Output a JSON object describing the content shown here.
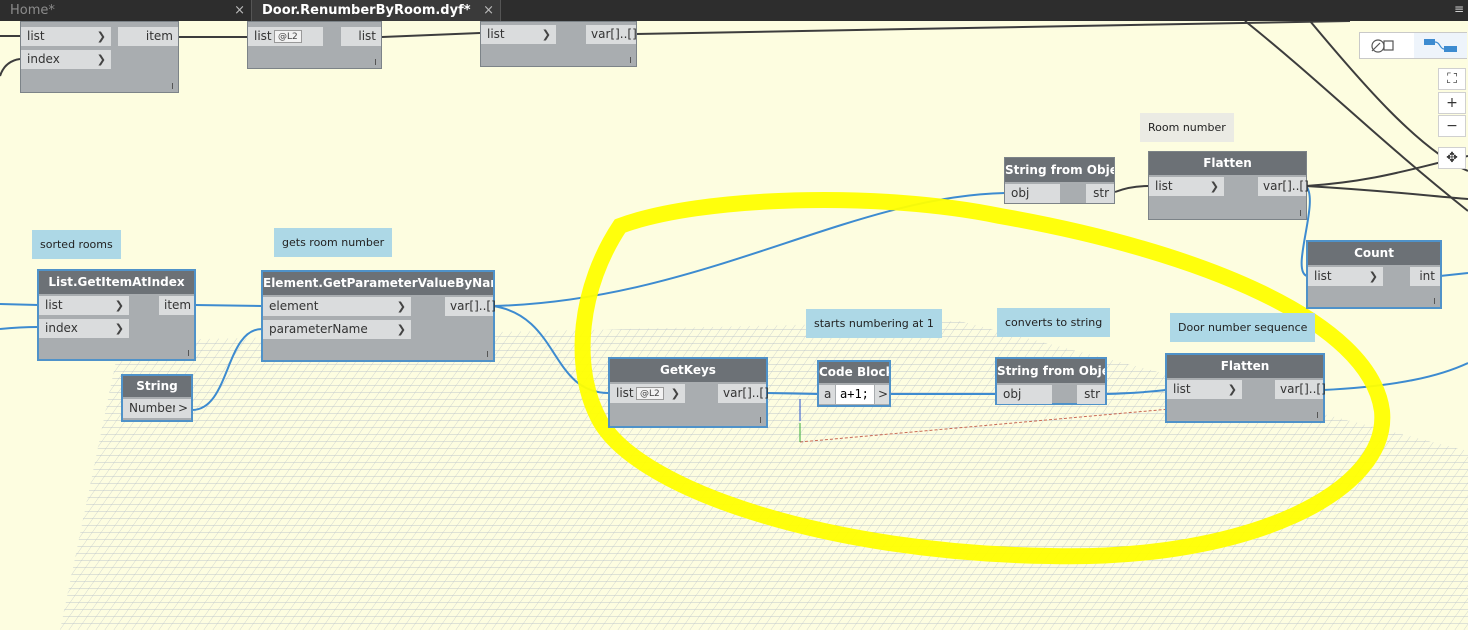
{
  "tabs": [
    {
      "label": "Home*",
      "close": "×"
    },
    {
      "label": "Door.RenumberByRoom.dyf*",
      "close": "×"
    }
  ],
  "window_menu": "≡",
  "nodes": {
    "top_getitem": {
      "in1": "list",
      "in2": "index",
      "out": "item"
    },
    "top_flatten": {
      "in1": "list",
      "lacing": "@L2",
      "out": "list"
    },
    "top_third": {
      "in1": "list",
      "out": "var[]..[]"
    },
    "list_getitem": {
      "title": "List.GetItemAtIndex",
      "in1": "list",
      "in2": "index",
      "out": "item"
    },
    "string": {
      "title": "String",
      "in1": "Number",
      "arrow": ">"
    },
    "get_param": {
      "title": "Element.GetParameterValueByName",
      "in1": "element",
      "in2": "parameterName",
      "out": "var[]..[]"
    },
    "getkeys": {
      "title": "GetKeys",
      "in1": "list",
      "lacing": "@L2",
      "out": "var[]..[]"
    },
    "codeblock": {
      "title": "Code Block",
      "in1": "a",
      "code": "a+1;",
      "out": ">"
    },
    "sfo1": {
      "title": "String from Object",
      "in1": "obj",
      "out": "str"
    },
    "sfo2": {
      "title": "String from Object",
      "in1": "obj",
      "out": "str"
    },
    "flatten1": {
      "title": "Flatten",
      "in1": "list",
      "out": "var[]..[]"
    },
    "flatten2": {
      "title": "Flatten",
      "in1": "list",
      "out": "var[]..[]"
    },
    "count": {
      "title": "Count",
      "in1": "list",
      "out": "int"
    }
  },
  "notes": {
    "sorted_rooms": "sorted rooms",
    "gets_room_number": "gets room number",
    "room_number": "Room number",
    "starts_numbering": "starts numbering at 1",
    "converts_to_string": "converts to string",
    "door_number_sequence": "Door number sequence"
  },
  "zoom_controls": {
    "fit": "⛶",
    "zoom_in": "+",
    "zoom_out": "−",
    "pan": "✥"
  },
  "view_toggle": {
    "geometry_icon": "geometry-view-icon",
    "graph_icon": "graph-view-icon"
  },
  "colors": {
    "canvas": "#fdfde0",
    "wire": "#3d8bd0",
    "highlight": "#ffff00",
    "node_title": "#6c7176",
    "selection": "#4f92c9"
  }
}
